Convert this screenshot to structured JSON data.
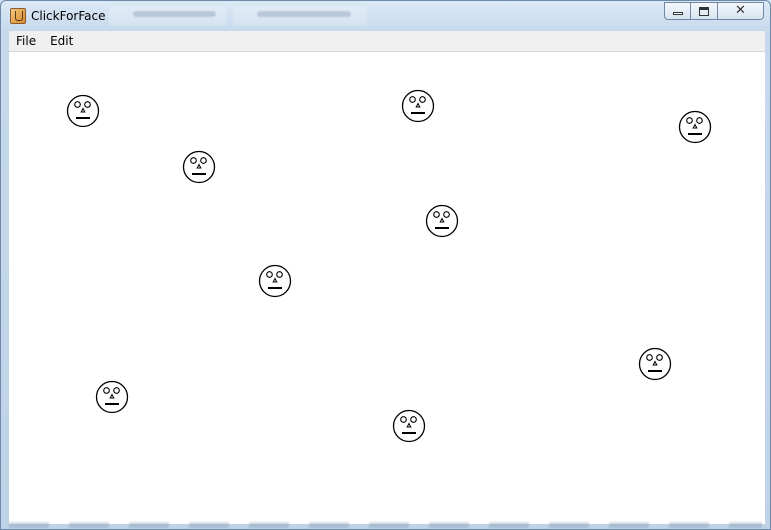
{
  "window": {
    "title": "ClickForFace",
    "controls": {
      "minimize_icon": "minimize-icon",
      "maximize_icon": "maximize-icon",
      "close_icon": "close-icon",
      "close_glyph": "✕"
    }
  },
  "menubar": {
    "items": [
      {
        "label": "File"
      },
      {
        "label": "Edit"
      }
    ]
  },
  "canvas": {
    "background": "#ffffff",
    "face_count": 9,
    "face_icon": "face-icon"
  }
}
